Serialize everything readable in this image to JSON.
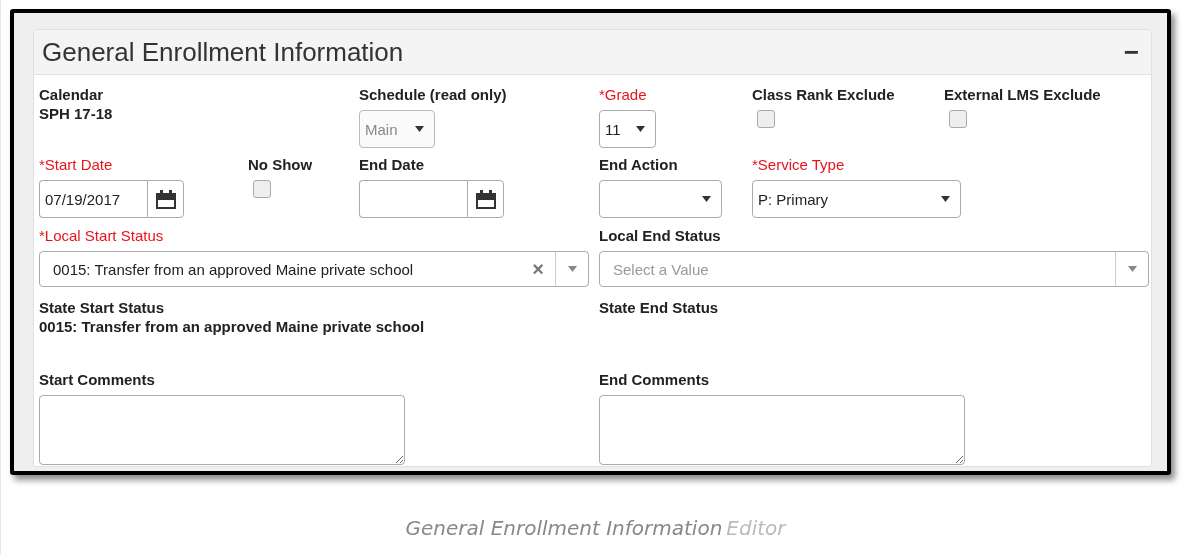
{
  "panel": {
    "title": "General Enrollment Information",
    "collapse": "−"
  },
  "rows": [
    [
      {
        "kind": "static",
        "label": "Calendar",
        "required": false,
        "value": "SPH 17-18"
      },
      {
        "kind": "select",
        "label": "Schedule (read only)",
        "required": false,
        "value": "Main",
        "disabled": true
      },
      {
        "kind": "select",
        "label": "*Grade",
        "required": true,
        "value": "11",
        "disabled": false
      },
      {
        "kind": "checkbox",
        "label": "Class Rank Exclude",
        "required": false,
        "checked": false
      },
      {
        "kind": "checkbox",
        "label": "External LMS Exclude",
        "required": false,
        "checked": false
      }
    ],
    [
      {
        "kind": "date",
        "label": "*Start Date",
        "required": true,
        "value": "07/19/2017"
      },
      {
        "kind": "checkbox",
        "label": "No Show",
        "required": false,
        "checked": false
      },
      {
        "kind": "date",
        "label": "End Date",
        "required": false
      },
      {
        "kind": "select",
        "label": "End Action",
        "required": false,
        "disabled": false
      },
      {
        "kind": "select",
        "label": "*Service Type",
        "required": true,
        "value": "P: Primary",
        "disabled": false
      }
    ],
    [
      {
        "kind": "combo",
        "label": "*Local Start Status",
        "required": true,
        "value": "0015: Transfer from an approved Maine private school",
        "clear": "×"
      },
      {
        "kind": "combo",
        "label": "Local End Status",
        "required": false,
        "placeholder": "Select a Value"
      }
    ],
    [
      {
        "kind": "static",
        "label": "State Start Status",
        "required": false,
        "value": "0015: Transfer from an approved Maine private school"
      },
      {
        "kind": "static",
        "label": "State End Status",
        "required": false
      }
    ],
    [
      {
        "kind": "textarea",
        "label": "Start Comments",
        "required": false
      },
      {
        "kind": "textarea",
        "label": "End Comments",
        "required": false
      }
    ]
  ],
  "caption": {
    "title": "General Enrollment Information",
    "suffix": "Editor"
  }
}
